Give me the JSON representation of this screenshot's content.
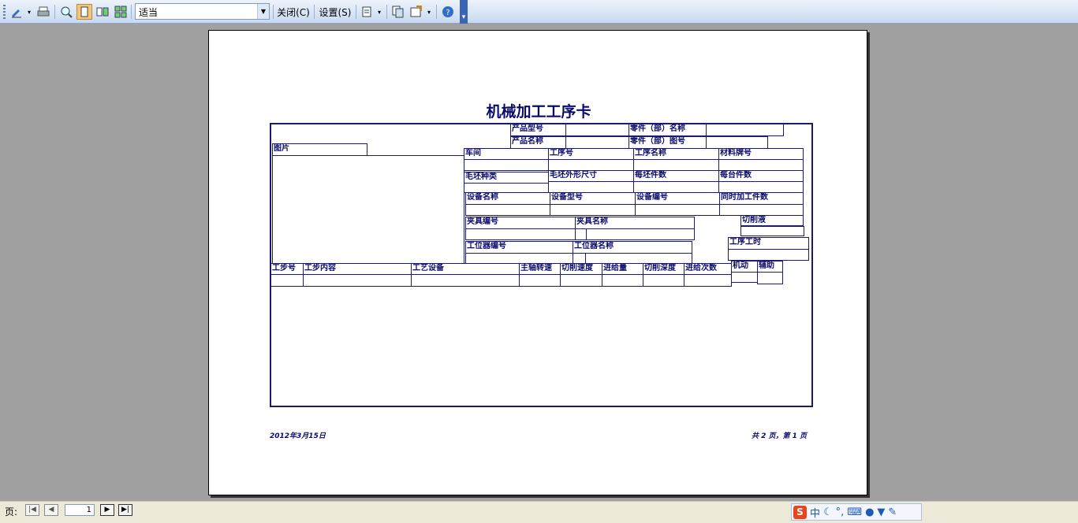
{
  "toolbar": {
    "zoom_value": "适当",
    "close_label": "关闭(C)",
    "settings_label": "设置(S)",
    "icons": [
      "edit-icon",
      "print-icon",
      "zoom-icon",
      "single-page-icon",
      "two-page-icon",
      "multi-page-icon",
      "layout-icon",
      "copy-icon",
      "export-icon",
      "help-icon"
    ]
  },
  "card": {
    "title": "机械加工工序卡",
    "product_model": "产品型号",
    "part_name": "零件（部）名称",
    "product_name": "产品名称",
    "part_drawing": "零件（部）图号",
    "picture": "图片",
    "workshop": "车间",
    "process_no": "工序号",
    "process_name": "工序名称",
    "material_grade": "材料牌号",
    "blank_type": "毛坯种类",
    "blank_size": "毛坯外形尺寸",
    "pieces_per_blank": "每坯件数",
    "pieces_per_unit": "每台件数",
    "equipment_name": "设备名称",
    "equipment_model": "设备型号",
    "equipment_no": "设备编号",
    "simultaneous": "同时加工件数",
    "fixture_no": "夹具编号",
    "fixture_name": "夹具名称",
    "coolant": "切削液",
    "station_no": "工位器编号",
    "station_name": "工位器名称",
    "process_time": "工序工时",
    "step_no": "工步号",
    "step_content": "工步内容",
    "process_equipment": "工艺设备",
    "spindle_speed": "主轴转速",
    "cutting_speed": "切削速度",
    "feed": "进给量",
    "cutting_depth": "切削深度",
    "feed_times": "进给次数",
    "machine": "机动",
    "auxiliary": "辅助"
  },
  "footer": {
    "date": "2012年3月15日",
    "page_info": "共 2 页，第 1 页"
  },
  "statusbar": {
    "page_label": "页:",
    "page_number": "1",
    "ime_label": "中"
  }
}
